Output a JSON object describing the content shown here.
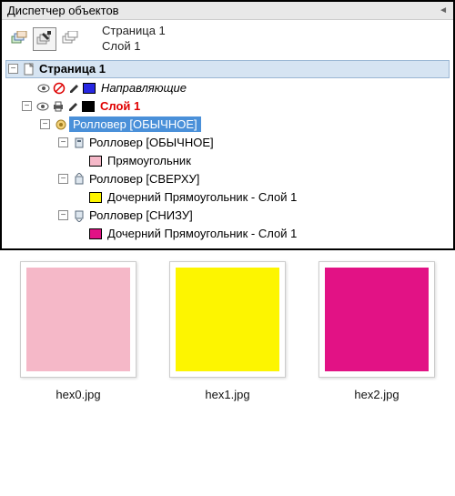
{
  "panel": {
    "title": "Диспетчер объектов"
  },
  "breadcrumb": {
    "page": "Страница 1",
    "layer": "Слой 1"
  },
  "tree": {
    "page": "Страница 1",
    "guides": "Направляющие",
    "layer": "Слой 1",
    "rollover_selected": "Ролловер  [ОБЫЧНОЕ]",
    "rollover_normal": "Ролловер  [ОБЫЧНОЕ]",
    "rect": "Прямоугольник",
    "rollover_over": "Ролловер  [СВЕРХУ]",
    "child_rect_over": "Дочерний Прямоугольник - Слой 1",
    "rollover_down": "Ролловер  [СНИЗУ]",
    "child_rect_down": "Дочерний Прямоугольник - Слой 1"
  },
  "swatches": [
    {
      "color": "#f5b8c8",
      "caption": "hex0.jpg"
    },
    {
      "color": "#fdf500",
      "caption": "hex1.jpg"
    },
    {
      "color": "#e21285",
      "caption": "hex2.jpg"
    }
  ],
  "colors": {
    "guide_swatch": "#2727e2",
    "layer_swatch": "#000000",
    "rect_swatch": "#f5b8c8",
    "over_swatch": "#fdf500",
    "down_swatch": "#e21285"
  }
}
